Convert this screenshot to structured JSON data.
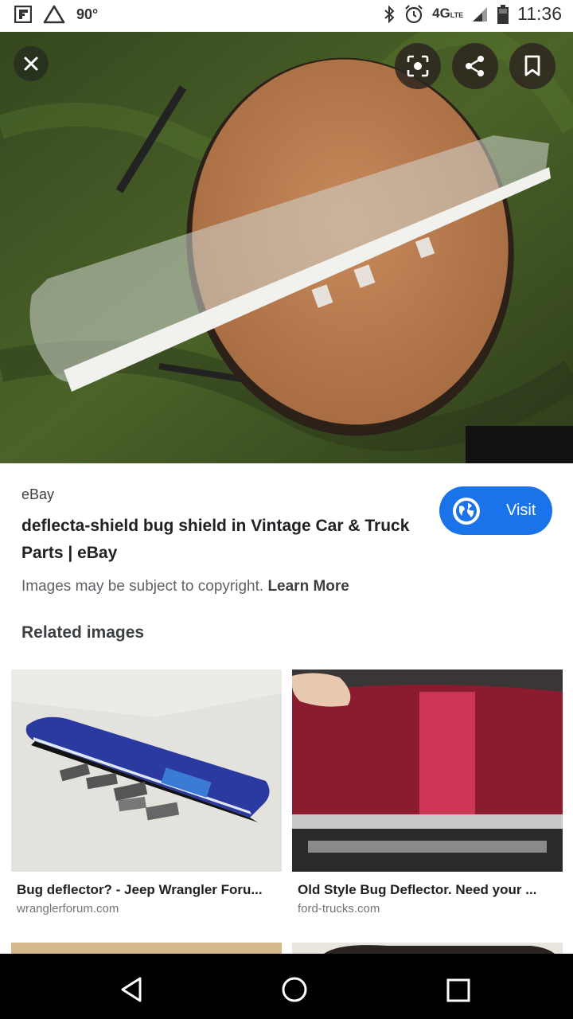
{
  "status_bar": {
    "temperature": "90°",
    "network": "4G",
    "network_sub": "LTE",
    "time": "11:36"
  },
  "overlay": {
    "icons": [
      "close-icon",
      "lens-icon",
      "share-icon",
      "bookmark-icon"
    ]
  },
  "result": {
    "source": "eBay",
    "title": "deflecta-shield bug shield in Vintage Car & Truck Parts | eBay",
    "visit_label": "Visit",
    "copyright_text": "Images may be subject to copyright.",
    "learn_more": "Learn More"
  },
  "related": {
    "heading": "Related images",
    "items": [
      {
        "title": "Bug deflector? - Jeep Wrangler Foru...",
        "domain": "wranglerforum.com"
      },
      {
        "title": "Old Style Bug Deflector. Need your ...",
        "domain": "ford-trucks.com"
      }
    ]
  },
  "colors": {
    "accent": "#1a73e8",
    "nav_bar": "#000000"
  }
}
